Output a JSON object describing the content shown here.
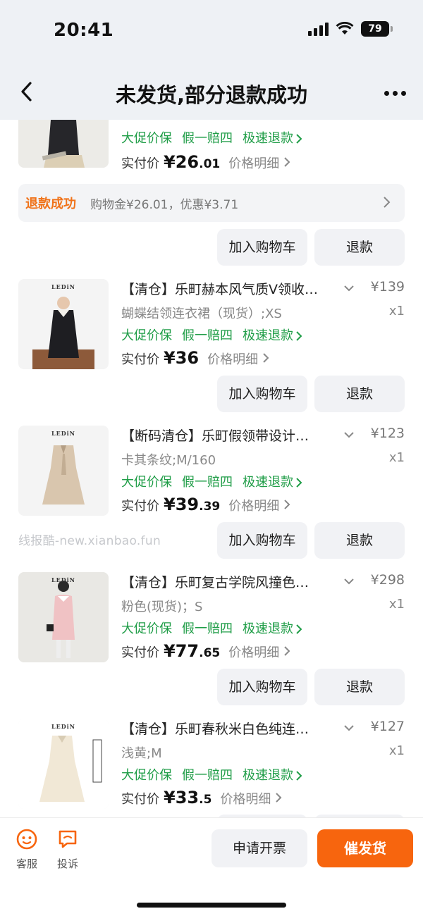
{
  "status_bar": {
    "time": "20:41",
    "battery": "79"
  },
  "header": {
    "title": "未发货,部分退款成功"
  },
  "top_item": {
    "tags": [
      "大促价保",
      "假一赔四",
      "极速退款"
    ],
    "paid_label": "实付价",
    "paid_int": "¥26",
    "paid_dec": ".01",
    "detail_label": "价格明细"
  },
  "refund_notice": {
    "status": "退款成功",
    "detail": "购物金¥26.01，优惠¥3.71"
  },
  "actions": {
    "add_to_cart": "加入购物车",
    "refund": "退款"
  },
  "watermark": "线报酷-new.xianbao.fun",
  "products": [
    {
      "title": "【清仓】乐町赫本风气质V领收…",
      "price": "¥139",
      "spec": "蝴蝶结领连衣裙（现货）;XS",
      "qty": "x1",
      "tags": [
        "大促价保",
        "假一赔四",
        "极速退款"
      ],
      "paid_label": "实付价",
      "paid_int": "¥36",
      "paid_dec": "",
      "detail_label": "价格明细",
      "image_brand": "LEDiN"
    },
    {
      "title": "【断码清仓】乐町假领带设计…",
      "price": "¥123",
      "spec": "卡其条纹;M/160",
      "qty": "x1",
      "tags": [
        "大促价保",
        "假一赔四",
        "极速退款"
      ],
      "paid_label": "实付价",
      "paid_int": "¥39",
      "paid_dec": ".39",
      "detail_label": "价格明细",
      "image_brand": "LEDiN"
    },
    {
      "title": "【清仓】乐町复古学院风撞色…",
      "price": "¥298",
      "spec": "粉色(现货)；S",
      "qty": "x1",
      "tags": [
        "大促价保",
        "假一赔四",
        "极速退款"
      ],
      "paid_label": "实付价",
      "paid_int": "¥77",
      "paid_dec": ".65",
      "detail_label": "价格明细",
      "image_brand": "LEDiN"
    },
    {
      "title": "【清仓】乐町春秋米白色纯连…",
      "price": "¥127",
      "spec": "浅黄;M",
      "qty": "x1",
      "tags": [
        "大促价保",
        "假一赔四",
        "极速退款"
      ],
      "paid_label": "实付价",
      "paid_int": "¥33",
      "paid_dec": ".5",
      "detail_label": "价格明细",
      "image_brand": "LEDiN"
    }
  ],
  "bottom_bar": {
    "service": "客服",
    "complaint": "投诉",
    "invoice": "申请开票",
    "urge": "催发货"
  },
  "colors": {
    "accent_orange": "#f7650e",
    "tag_green": "#1f9d47",
    "refund_orange": "#f0731a"
  }
}
